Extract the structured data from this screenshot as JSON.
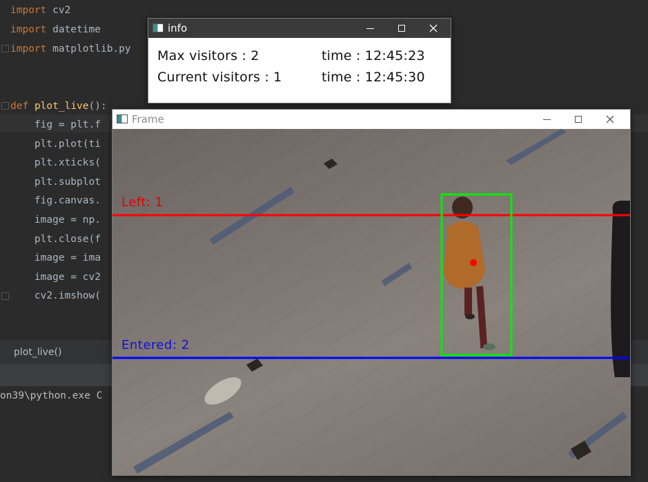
{
  "editor": {
    "lines": [
      {
        "kw": "import",
        "rest": " cv2"
      },
      {
        "kw": "import",
        "rest": " datetime"
      },
      {
        "kw": "import",
        "rest": " matplotlib.py"
      },
      {
        "kw": "",
        "rest": ""
      },
      {
        "kw": "",
        "rest": ""
      },
      {
        "kw": "def",
        "fn": "plot_live",
        "rest": "():"
      },
      {
        "kw": "",
        "rest": "    fig = plt.f"
      },
      {
        "kw": "",
        "rest": "    plt.plot(ti"
      },
      {
        "kw": "",
        "rest": "    plt.xticks("
      },
      {
        "kw": "",
        "rest": "    plt.subplot"
      },
      {
        "kw": "",
        "rest": "    fig.canvas."
      },
      {
        "kw": "",
        "rest": "    image = np."
      },
      {
        "kw": "",
        "rest": "    plt.close(f"
      },
      {
        "kw": "",
        "rest": "    image = ima"
      },
      {
        "kw": "",
        "rest": "    image = cv2"
      },
      {
        "kw": "",
        "rest": "    cv2.imshow("
      }
    ],
    "colors": {
      "keyword": "#cc7832",
      "function": "#ffc66d",
      "text": "#a9b7c6",
      "background": "#2b2b2b"
    }
  },
  "breadcrumb": {
    "label": "plot_live()"
  },
  "console": {
    "text": "on39\\python.exe C"
  },
  "info_window": {
    "title": "info",
    "rows": [
      {
        "label": "Max visitors : 2",
        "time": "time : 12:45:23"
      },
      {
        "label": "Current visitors : 1",
        "time": "time : 12:45:30"
      }
    ]
  },
  "frame_window": {
    "title": "Frame",
    "overlays": {
      "left_label": "Left: 1",
      "entered_label": "Entered: 2",
      "left_line_color": "#ff0000",
      "entered_line_color": "#0000ff",
      "bbox_color": "#00ff00",
      "centroid_color": "#ff0000"
    }
  },
  "icons": {
    "window": "window-app-icon",
    "minimize": "minimize-icon",
    "maximize": "maximize-icon",
    "close": "close-icon"
  }
}
